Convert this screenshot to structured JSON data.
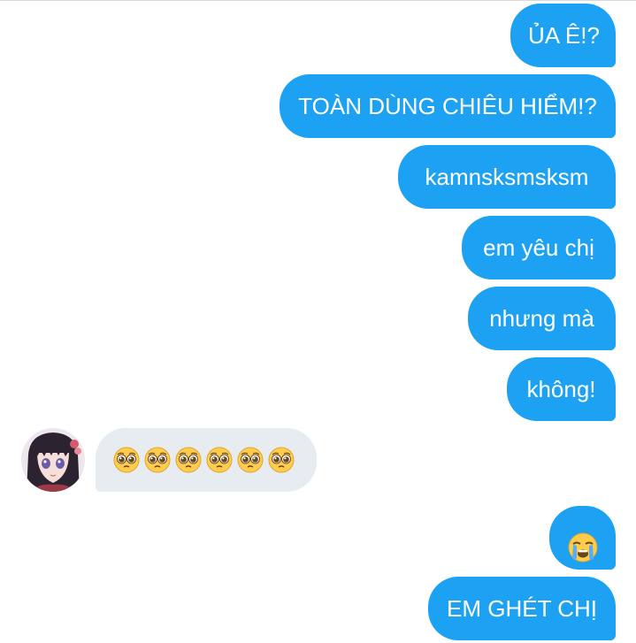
{
  "conversation": {
    "messages": [
      {
        "side": "sent",
        "text": "ỦA Ê!?"
      },
      {
        "side": "sent",
        "text": "TOÀN DÙNG CHIÊU HIỂM!?"
      },
      {
        "side": "sent",
        "text": "kamnsksmsksm"
      },
      {
        "side": "sent",
        "text": "em yêu chị"
      },
      {
        "side": "sent",
        "text": "nhưng mà"
      },
      {
        "side": "sent",
        "text": "không!"
      },
      {
        "side": "received",
        "emoji": "pleading-face",
        "count": 6
      },
      {
        "side": "sent",
        "emoji": "loudly-crying-face"
      },
      {
        "side": "sent",
        "text": "EM GHÉT CHỊ"
      }
    ]
  },
  "colors": {
    "sent_bubble": "#1da1f2",
    "received_bubble": "#e6ecf0",
    "sent_text": "#ffffff",
    "received_text": "#14171a"
  },
  "contact": {
    "avatar_icon": "anime-avatar"
  }
}
